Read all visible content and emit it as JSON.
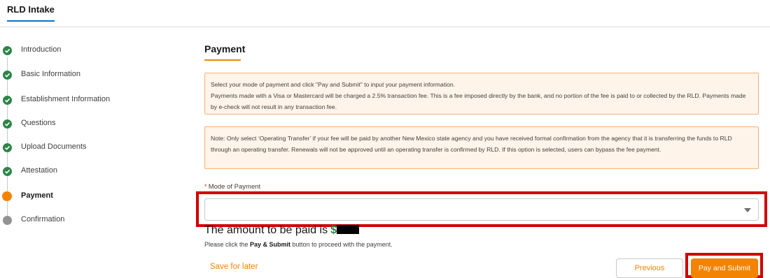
{
  "header": {
    "tab_label": "RLD Intake"
  },
  "steps": [
    {
      "label": "Introduction",
      "status": "completed"
    },
    {
      "label": "Basic Information",
      "status": "completed"
    },
    {
      "label": "Establishment Information",
      "status": "completed"
    },
    {
      "label": "Questions",
      "status": "completed"
    },
    {
      "label": "Upload Documents",
      "status": "completed"
    },
    {
      "label": "Attestation",
      "status": "completed"
    },
    {
      "label": "Payment",
      "status": "current"
    },
    {
      "label": "Confirmation",
      "status": "pending"
    }
  ],
  "section": {
    "title": "Payment"
  },
  "notices": {
    "payment_info": {
      "line1": "Select your mode of payment and click \"Pay and Submit\" to input your payment information.",
      "line2": "Payments made with a Visa or Mastercard will be charged a 2.5% transaction fee. This is a fee imposed directly by the bank, and no portion of the fee is paid to or collected by the RLD. Payments made by e-check will not result in any transaction fee."
    },
    "operating_transfer": {
      "text": "Note: Only select ‘Operating Transfer’ if your fee will be paid by another New Mexico state agency and you have received formal confirmation from the agency that it is transferring the funds to RLD through an operating transfer. Renewals will not be approved until an operating transfer is confirmed by RLD. If this option is selected, users can bypass the fee payment."
    }
  },
  "payment_mode": {
    "required_marker": "*",
    "label": "Mode of Payment",
    "selected_value": ""
  },
  "amount": {
    "prefix": "The amount to be paid is",
    "currency": "$"
  },
  "instruction": {
    "before": "Please click the ",
    "button_name": "Pay & Submit",
    "after": " button to proceed with the payment."
  },
  "actions": {
    "save_for_later": "Save for later",
    "previous": "Previous",
    "pay_and_submit": "Pay and Submit"
  },
  "colors": {
    "accent": "#f38303",
    "success": "#2e844a",
    "highlight": "#d10000",
    "notice_bg": "#fff4ea"
  }
}
